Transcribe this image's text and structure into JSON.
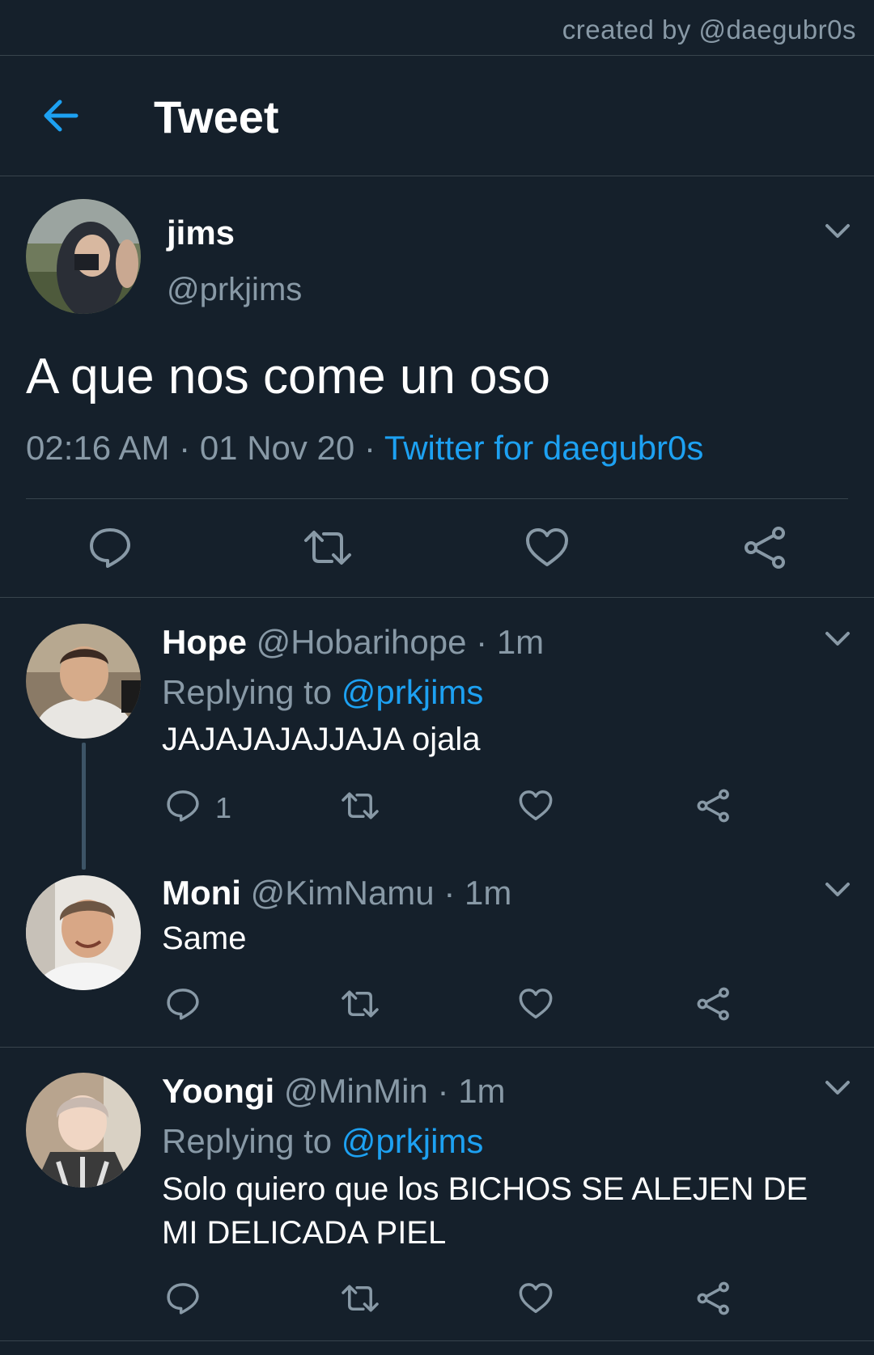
{
  "watermark": "created by @daegubr0s",
  "header": {
    "title": "Tweet",
    "back_icon": "arrow-left-icon"
  },
  "colors": {
    "background": "#15202b",
    "accent": "#1da1f2",
    "muted": "#8899a6",
    "divider": "#38444d"
  },
  "main_tweet": {
    "name": "jims",
    "handle": "@prkjims",
    "text": "A que nos come un oso",
    "time": "02:16 AM",
    "date": "01 Nov 20",
    "source": "Twitter for daegubr0s",
    "actions": [
      "reply-icon",
      "retweet-icon",
      "like-icon",
      "share-icon"
    ]
  },
  "replies": [
    {
      "name": "Hope",
      "handle": "@Hobarihope",
      "time": "1m",
      "replying_label": "Replying to",
      "replying_to": "@prkjims",
      "text": "JAJAJAJAJJAJA ojala",
      "reply_count": "1"
    },
    {
      "name": "Moni",
      "handle": "@KimNamu",
      "time": "1m",
      "text": "Same"
    },
    {
      "name": "Yoongi",
      "handle": "@MinMin",
      "time": "1m",
      "replying_label": "Replying to",
      "replying_to": "@prkjims",
      "text": "Solo quiero que los BICHOS SE ALEJEN DE MI DELICADA PIEL"
    }
  ],
  "separator": "·"
}
